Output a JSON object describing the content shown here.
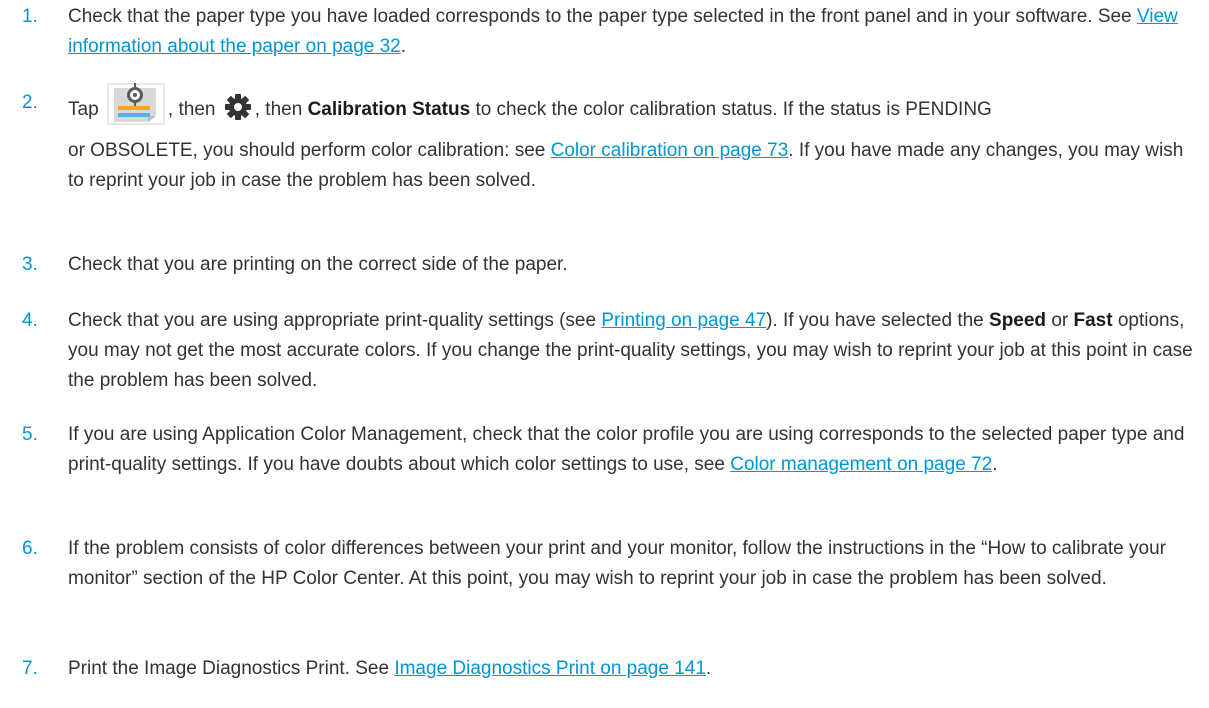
{
  "steps": [
    {
      "number": "1.",
      "text_before": "Check that the paper type you have loaded corresponds to the paper type selected in the front panel and in your software. See ",
      "link": "View information about the paper on page 32",
      "text_after": "."
    },
    {
      "number": "2.",
      "tap": "Tap",
      "then1": ", then",
      "then2": ", then",
      "calibration_status": "Calibration Status",
      "line1_rest": "to check the color calibration status. If the status is PENDING",
      "line2_start": "or OBSOLETE, you should perform color calibration: see ",
      "link": "Color calibration on page 73",
      "line2_rest": ". If you have made any changes, you may wish to reprint your job in case the problem has been solved.",
      "icons": {
        "panel": "paper-calibration-icon",
        "gear": "gear-icon"
      },
      "icon_colors": {
        "target_fill": "#5a5a5a",
        "sheet": "#d8d8d8",
        "orange_bar": "#f5a623",
        "blue_bar": "#4fb3e8",
        "gear": "#333333"
      }
    },
    {
      "number": "3.",
      "text": "Check that you are printing on the correct side of the paper."
    },
    {
      "number": "4.",
      "text_before": "Check that you are using appropriate print-quality settings (see ",
      "link": "Printing on page 47",
      "text_mid": "). If you have selected the ",
      "bold1": "Speed",
      "or": " or ",
      "bold2": "Fast",
      "text_after": " options, you may not get the most accurate colors. If you change the print-quality settings, you may wish to reprint your job at this point in case the problem has been solved."
    },
    {
      "number": "5.",
      "text_before": "If you are using Application Color Management, check that the color profile you are using corresponds to the selected paper type and print-quality settings. If you have doubts about which color settings to use, see ",
      "link": "Color management on page 72",
      "text_after": "."
    },
    {
      "number": "6.",
      "text": "If the problem consists of color differences between your print and your monitor, follow the instructions in the “How to calibrate your monitor” section of the HP Color Center. At this point, you may wish to reprint your job in case the problem has been solved."
    },
    {
      "number": "7.",
      "text_before": "Print the Image Diagnostics Print. See ",
      "link": "Image Diagnostics Print on page 141",
      "text_after": "."
    }
  ],
  "colors": {
    "accent": "#0096d6",
    "text": "#333333"
  }
}
